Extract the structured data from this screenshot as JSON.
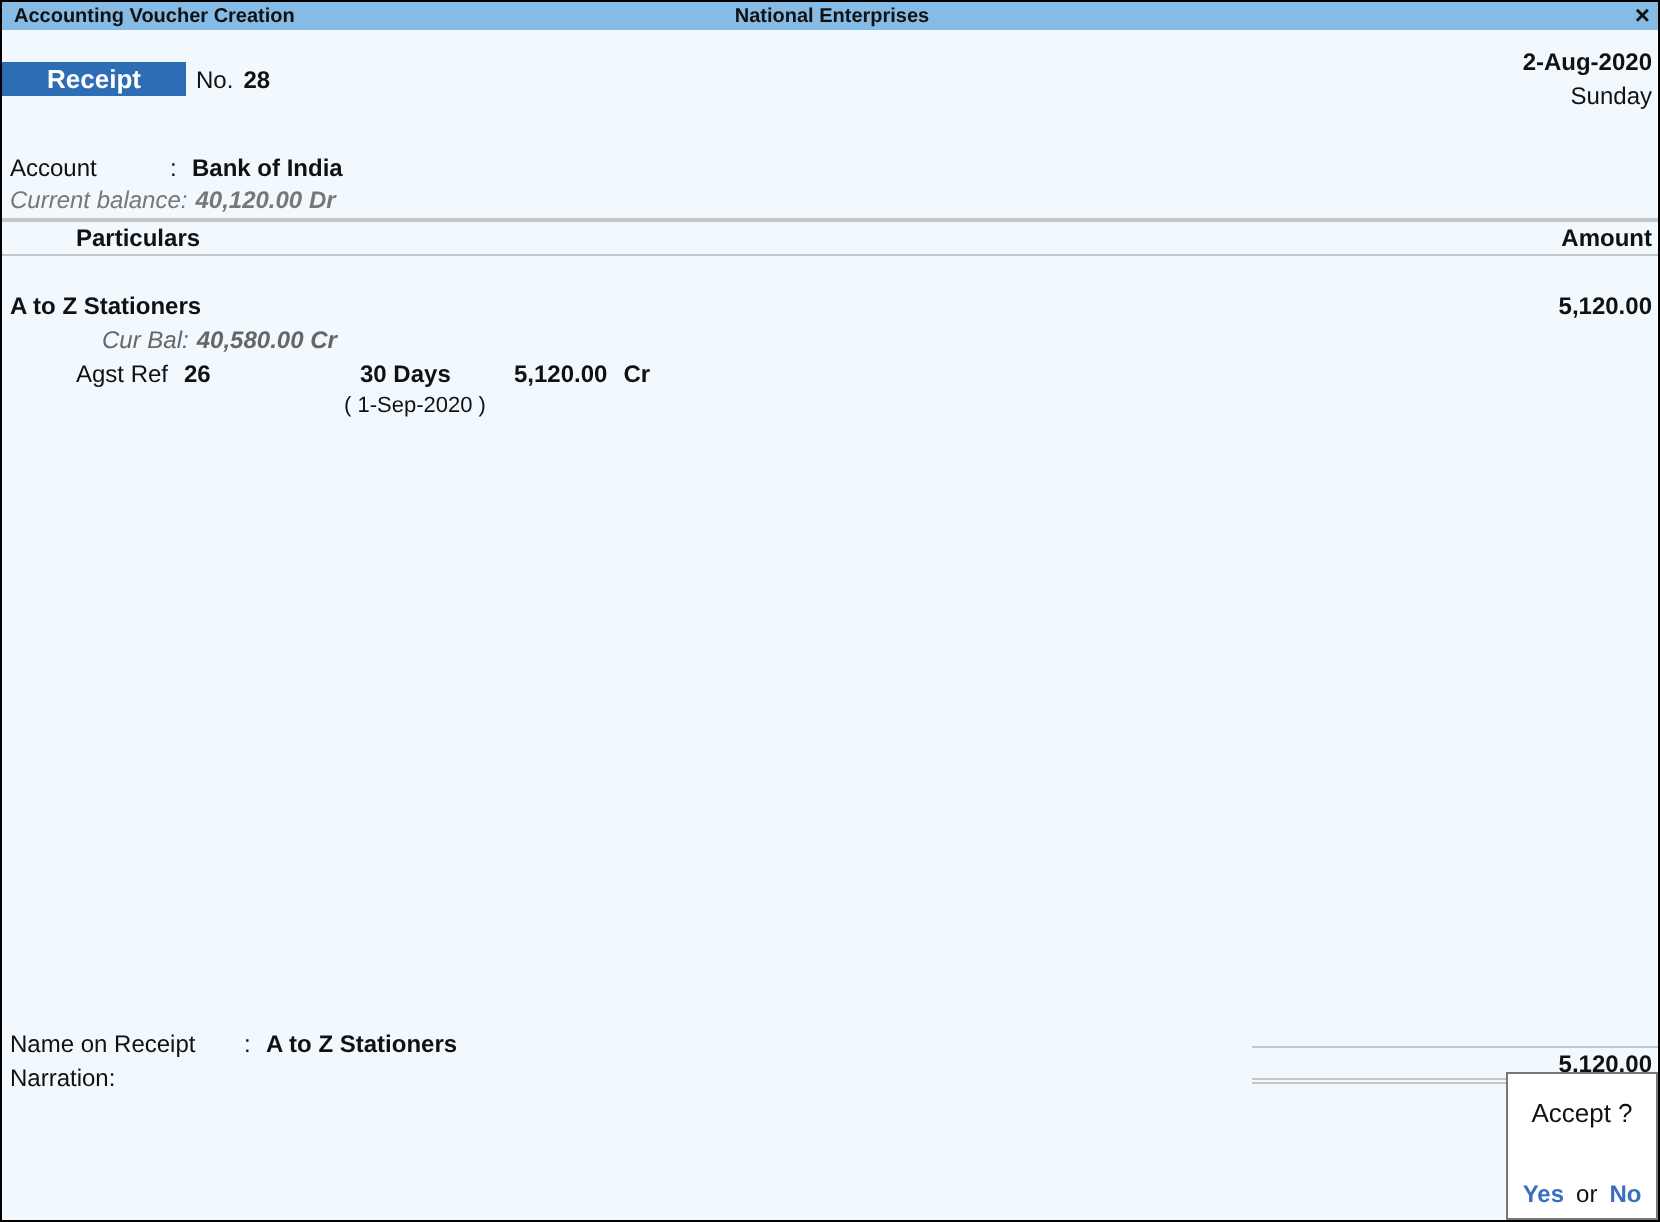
{
  "window": {
    "title": "Accounting Voucher Creation",
    "company": "National Enterprises",
    "close": "×"
  },
  "voucher": {
    "type": "Receipt",
    "number_label": "No.",
    "number": "28",
    "date": "2-Aug-2020",
    "day": "Sunday"
  },
  "account": {
    "label": "Account",
    "separator": ":",
    "value": "Bank of India",
    "balance_label": "Current balance:",
    "balance": "40,120.00 Dr"
  },
  "table": {
    "columns": [
      "Particulars",
      "Amount"
    ],
    "rows": [
      {
        "name": "A to Z Stationers",
        "amount": "5,120.00",
        "balance_label": "Cur Bal:",
        "balance": "40,580.00 Cr",
        "bills": [
          {
            "type": "Agst Ref",
            "ref": "26",
            "credit_period": "30 Days",
            "due_date": "( 1-Sep-2020 )",
            "amount": "5,120.00",
            "side": "Cr"
          }
        ]
      }
    ]
  },
  "footer": {
    "name_label": "Name on Receipt",
    "separator": ":",
    "name_value": "A to Z Stationers",
    "narration_label": "Narration:",
    "total": "5,120.00"
  },
  "dialog": {
    "question": "Accept ?",
    "yes": "Yes",
    "or": "or",
    "no": "No"
  }
}
